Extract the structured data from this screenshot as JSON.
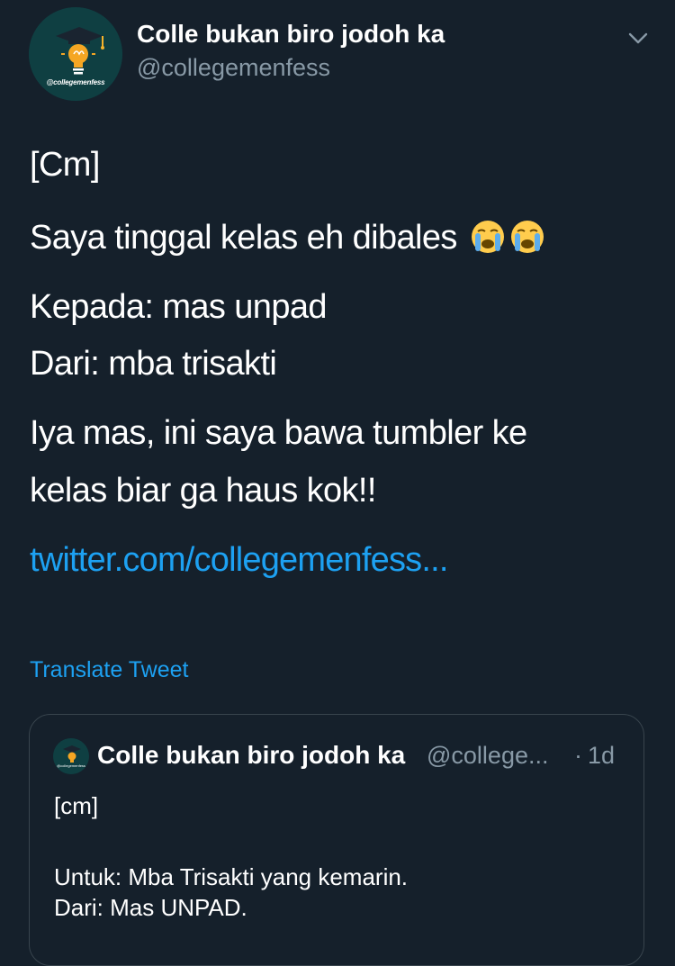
{
  "tweet": {
    "avatar_label": "@collegemenfess",
    "display_name": "Colle bukan biro jodoh ka",
    "handle": "@collegemenfess",
    "lines": [
      "[Cm]",
      "Saya tinggal kelas eh dibales",
      "Kepada: mas unpad",
      "Dari: mba trisakti",
      "Iya mas, ini saya bawa tumbler ke",
      "kelas biar ga haus kok!!"
    ],
    "emoji": [
      "crying-face",
      "crying-face"
    ],
    "link": "twitter.com/collegemenfess...",
    "translate_label": "Translate Tweet"
  },
  "quoted": {
    "avatar_label": "@collegemenfess",
    "display_name": "Colle bukan biro jodoh ka",
    "handle": "@college...",
    "dot": "·",
    "time": "1d",
    "lines": [
      "[cm]",
      "Untuk: Mba Trisakti yang kemarin.",
      "Dari: Mas UNPAD."
    ]
  },
  "colors": {
    "background": "#15202b",
    "text": "#ffffff",
    "secondary_text": "#8899a6",
    "accent": "#1da1f2",
    "border": "#38444d"
  }
}
